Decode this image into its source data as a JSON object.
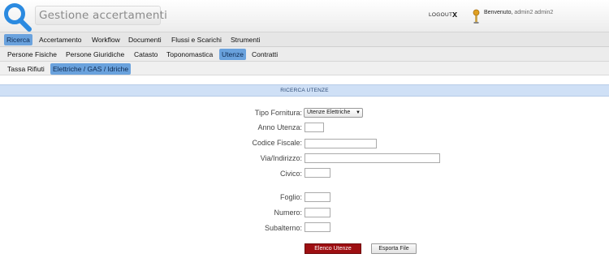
{
  "header": {
    "title": "Gestione accertamenti",
    "logout_label": "LOGOUT",
    "logout_x": "x",
    "welcome_label": "Benvenuto,",
    "user_name": "admin2 admin2"
  },
  "menu_main": {
    "items": [
      "Ricerca",
      "Accertamento",
      "Workflow",
      "Documenti",
      "Flussi e Scarichi",
      "Strumenti"
    ],
    "active": "Ricerca"
  },
  "menu_sub": {
    "items": [
      "Persone Fisiche",
      "Persone Giuridiche",
      "Catasto",
      "Toponomastica",
      "Utenze",
      "Contratti"
    ],
    "active": "Utenze"
  },
  "menu_sub2": {
    "items": [
      "Tassa Rifiuti",
      "Elettriche / GAS / Idriche"
    ],
    "active": "Elettriche / GAS / Idriche"
  },
  "section_title": "RICERCA UTENZE",
  "form": {
    "tipo_fornitura": {
      "label": "Tipo Fornitura:",
      "value": "Utenze Elettriche"
    },
    "anno_utenza": {
      "label": "Anno Utenza:",
      "value": ""
    },
    "codice_fiscale": {
      "label": "Codice Fiscale:",
      "value": ""
    },
    "via_indirizzo": {
      "label": "Via/Indirizzo:",
      "value": ""
    },
    "civico": {
      "label": "Civico:",
      "value": ""
    },
    "foglio": {
      "label": "Foglio:",
      "value": ""
    },
    "numero": {
      "label": "Numero:",
      "value": ""
    },
    "subalterno": {
      "label": "Subalterno:",
      "value": ""
    }
  },
  "buttons": {
    "elenco": "Elenco Utenze",
    "esporta": "Esporta File"
  },
  "colors": {
    "accent": "#2b8ae0",
    "menu_active": "#6aa2dd",
    "primary_button": "#9e0f12",
    "section_bar": "#cfe0f6"
  }
}
